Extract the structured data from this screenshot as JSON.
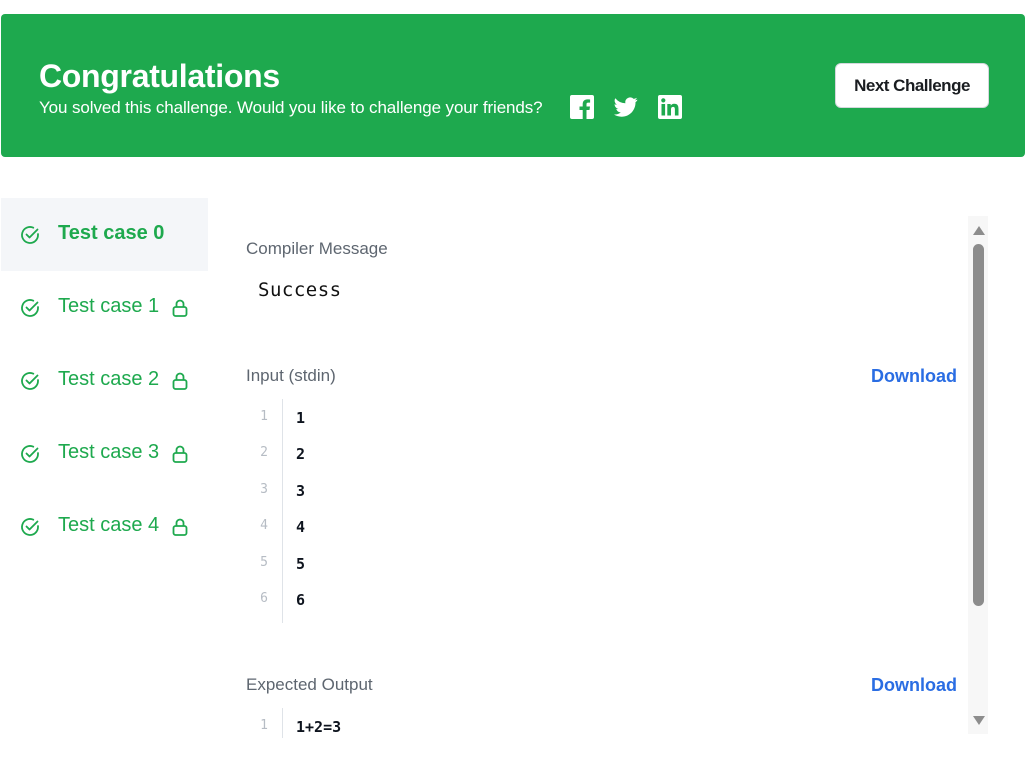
{
  "banner": {
    "title": "Congratulations",
    "subtitle": "You solved this challenge. Would you like to challenge your friends?",
    "share_icons": [
      "facebook-icon",
      "twitter-icon",
      "linkedin-icon"
    ],
    "next_button": "Next Challenge",
    "color": "#1ea94e"
  },
  "sidebar": {
    "items": [
      {
        "label": "Test case 0",
        "active": true,
        "locked": false
      },
      {
        "label": "Test case 1",
        "active": false,
        "locked": true
      },
      {
        "label": "Test case 2",
        "active": false,
        "locked": true
      },
      {
        "label": "Test case 3",
        "active": false,
        "locked": true
      },
      {
        "label": "Test case 4",
        "active": false,
        "locked": true
      }
    ]
  },
  "compiler": {
    "label": "Compiler Message",
    "message": "Success"
  },
  "input": {
    "label": "Input (stdin)",
    "download": "Download",
    "lines": [
      {
        "num": "1",
        "text": "1"
      },
      {
        "num": "2",
        "text": "2"
      },
      {
        "num": "3",
        "text": "3"
      },
      {
        "num": "4",
        "text": "4"
      },
      {
        "num": "5",
        "text": "5"
      },
      {
        "num": "6",
        "text": "6"
      }
    ]
  },
  "expected": {
    "label": "Expected Output",
    "download": "Download",
    "lines": [
      {
        "num": "1",
        "text": "1+2=3"
      }
    ]
  },
  "colors": {
    "success": "#1ea94e",
    "link": "#2a6de3"
  }
}
